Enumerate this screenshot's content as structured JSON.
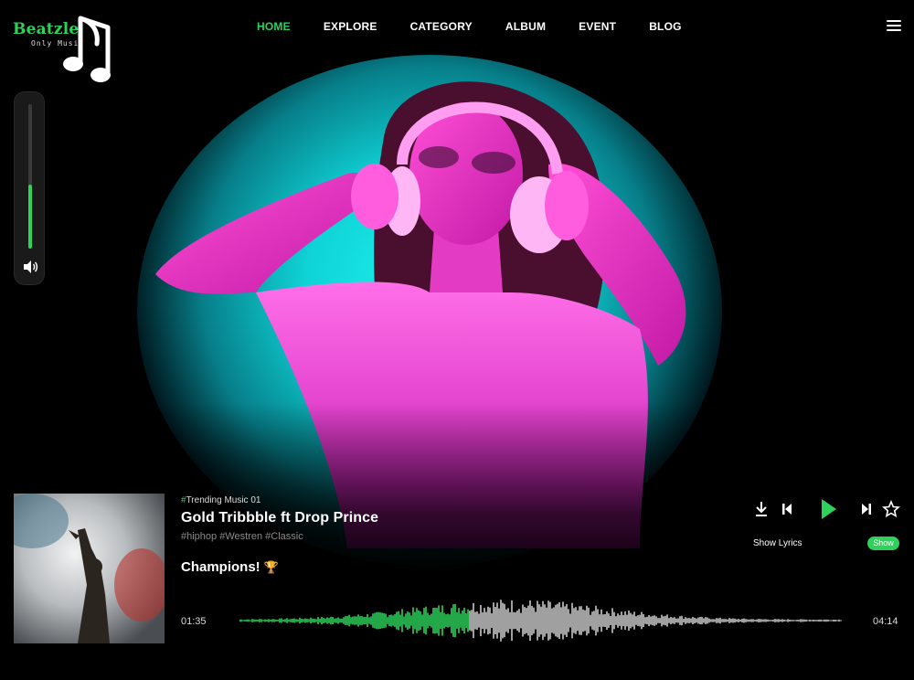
{
  "brand": {
    "name": "Beatzle",
    "tagline": "Only Music",
    "accent": "#2ed15a"
  },
  "nav": {
    "items": [
      {
        "label": "HOME",
        "active": true
      },
      {
        "label": "EXPLORE",
        "active": false
      },
      {
        "label": "CATEGORY",
        "active": false
      },
      {
        "label": "ALBUM",
        "active": false
      },
      {
        "label": "EVENT",
        "active": false
      },
      {
        "label": "BLOG",
        "active": false
      }
    ],
    "menu_icon": "hamburger-icon"
  },
  "volume": {
    "level": 0.44,
    "icon": "speaker-icon"
  },
  "player": {
    "trend_hash": "#",
    "trend_label": "Trending Music 01",
    "title": "Gold Tribbble ft  Drop Prince",
    "tags": "#hiphop #Westren #Classic",
    "subtitle": "Champions!",
    "trophy_icon": "trophy-icon",
    "current_time": "01:35",
    "total_time": "04:14",
    "progress": 0.38,
    "show_lyrics_label": "Show Lyrics",
    "show_button": "Show",
    "controls": [
      "download-icon",
      "previous-icon",
      "play-icon",
      "next-icon",
      "star-icon"
    ]
  }
}
